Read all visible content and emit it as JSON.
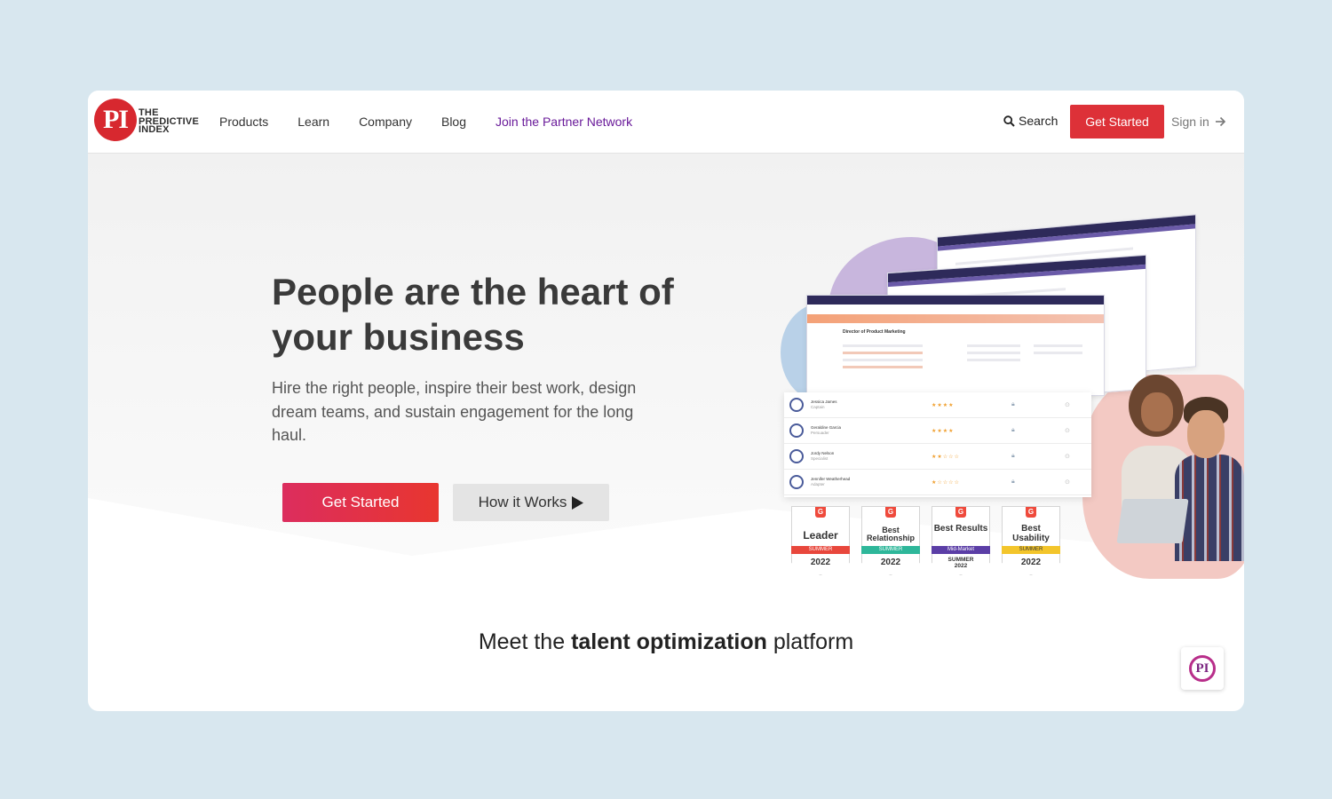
{
  "nav": {
    "logo_mark": "PI",
    "logo_line1": "THE",
    "logo_line2": "PREDICTIVE",
    "logo_line3": "INDEX",
    "links": [
      "Products",
      "Learn",
      "Company",
      "Blog",
      "Join the Partner Network"
    ],
    "search_label": "Search",
    "get_started": "Get Started",
    "sign_in": "Sign in"
  },
  "hero": {
    "headline": "People are the heart of your business",
    "subtext": "Hire the right people, inspire their best work, design dream teams, and sustain engagement for the long haul.",
    "primary_button": "Get Started",
    "secondary_button": "How it Works"
  },
  "illustration": {
    "panel_title": "Director of Product Marketing",
    "people": [
      {
        "name": "Jessica James",
        "role": "Captain",
        "stars": "★★★★",
        "rating": 4
      },
      {
        "name": "Geraldine Garcia",
        "role": "Persuader",
        "stars": "★★★★",
        "rating": 3.5
      },
      {
        "name": "Jordy Nelson",
        "role": "Specialist",
        "stars": "★★☆☆☆",
        "rating": 1.5
      },
      {
        "name": "Jennifer Weatherhead",
        "role": "Adapter",
        "stars": "★☆☆☆☆",
        "rating": 1
      }
    ],
    "badges": [
      {
        "title": "Leader",
        "ribbon": "SUMMER",
        "year": "2022",
        "color": "#e8473c"
      },
      {
        "title": "Best Relationship",
        "ribbon": "SUMMER",
        "year": "2022",
        "color": "#2eb79a"
      },
      {
        "title": "Best Results",
        "ribbon": "Mid-Market",
        "year": "SUMMER 2022",
        "color": "#5b3ea6"
      },
      {
        "title": "Best Usability",
        "ribbon": "SUMMER",
        "year": "2022",
        "color": "#f3c52b"
      }
    ]
  },
  "tagline": {
    "prefix": "Meet the ",
    "bold": "talent optimization",
    "suffix": " platform"
  },
  "chat_widget": {
    "label": "PI"
  },
  "colors": {
    "brand_red": "#dd3138",
    "partner_purple": "#6a1b9a",
    "background": "#d8e7ef"
  }
}
